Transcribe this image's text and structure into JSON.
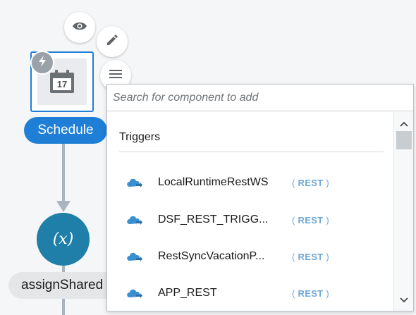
{
  "flow": {
    "trigger_label": "Schedule",
    "calendar_day": "17",
    "variable_symbol": "(x)",
    "assign_label": "assignShared"
  },
  "popup": {
    "search_placeholder": "Search for component to add",
    "section_title": "Triggers",
    "items": [
      {
        "name": "LocalRuntimeRestWS",
        "type": "REST",
        "icon": "cloud-adapter-icon"
      },
      {
        "name": "DSF_REST_TRIGG...",
        "type": "REST",
        "icon": "cloud-adapter-icon"
      },
      {
        "name": "RestSyncVacationP...",
        "type": "REST",
        "icon": "cloud-adapter-icon"
      },
      {
        "name": "APP_REST",
        "type": "REST",
        "icon": "cloud-adapter-icon"
      }
    ]
  },
  "colors": {
    "accent": "#1f7fd6",
    "variable_node": "#1f7fa8",
    "badge_text": "#6fa7d6"
  }
}
